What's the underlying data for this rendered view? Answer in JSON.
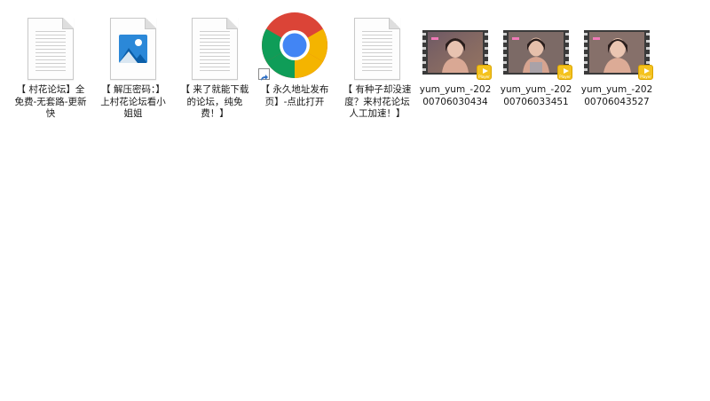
{
  "desktop": {
    "items": [
      {
        "label": "【 村花论坛】全免费-无套路-更新快",
        "icon": "text-document-icon"
      },
      {
        "label": "【 解压密码：】上村花论坛看小姐姐",
        "icon": "image-file-icon"
      },
      {
        "label": "【 来了就能下载的论坛，纯免费！】",
        "icon": "text-document-icon"
      },
      {
        "label": "【 永久地址发布页】-点此打开",
        "icon": "chrome-shortcut-icon"
      },
      {
        "label": "【 有种子却没速度？来村花论坛人工加速！】",
        "icon": "text-document-icon"
      },
      {
        "label": "yum_yum_-20200706030434",
        "icon": "video-file-icon",
        "badge": "Player"
      },
      {
        "label": "yum_yum_-20200706033451",
        "icon": "video-file-icon",
        "badge": "Player"
      },
      {
        "label": "yum_yum_-20200706043527",
        "icon": "video-file-icon",
        "badge": "Player"
      }
    ]
  },
  "colors": {
    "background": "#ffffff",
    "label_text": "#1a1a1a",
    "player_badge": "#f4c21e",
    "chrome_red": "#db4437",
    "chrome_yellow": "#f4b400",
    "chrome_green": "#0f9d58",
    "chrome_blue": "#4285f4"
  }
}
